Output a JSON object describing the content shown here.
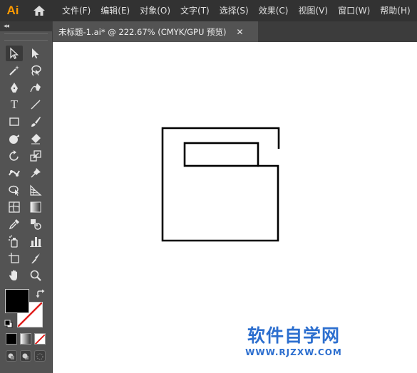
{
  "app": {
    "logo_text": "Ai",
    "logo_color": "#ff9a00"
  },
  "menubar": {
    "items": [
      "文件(F)",
      "编辑(E)",
      "对象(O)",
      "文字(T)",
      "选择(S)",
      "效果(C)",
      "视图(V)",
      "窗口(W)",
      "帮助(H)"
    ]
  },
  "toolpanel": {
    "collapse_label": "◂◂",
    "tools": [
      [
        "selection-tool",
        "direct-selection-tool"
      ],
      [
        "magic-wand-tool",
        "lasso-tool"
      ],
      [
        "pen-tool",
        "curvature-tool"
      ],
      [
        "type-tool",
        "line-segment-tool"
      ],
      [
        "rectangle-tool",
        "paintbrush-tool"
      ],
      [
        "shaper-tool",
        "eraser-tool"
      ],
      [
        "rotate-tool",
        "scale-tool"
      ],
      [
        "puppet-warp-tool",
        "pin-tool"
      ],
      [
        "shape-builder-tool",
        "perspective-grid-tool"
      ],
      [
        "mesh-tool",
        "gradient-tool"
      ],
      [
        "eyedropper-tool",
        "blend-tool"
      ],
      [
        "symbol-sprayer-tool",
        "column-graph-tool"
      ],
      [
        "artboard-tool",
        "slice-tool"
      ],
      [
        "hand-tool",
        "zoom-tool"
      ]
    ],
    "type_tool_glyph": "T",
    "fill_color": "#000000",
    "stroke_color": "#ffffff"
  },
  "document": {
    "tab_title": "未标题-1.ai* @ 222.67% (CMYK/GPU 预览)",
    "close_glyph": "✕"
  },
  "watermark": {
    "title": "软件自学网",
    "url": "WWW.RJZXW.COM",
    "color": "#2d6fcf"
  }
}
